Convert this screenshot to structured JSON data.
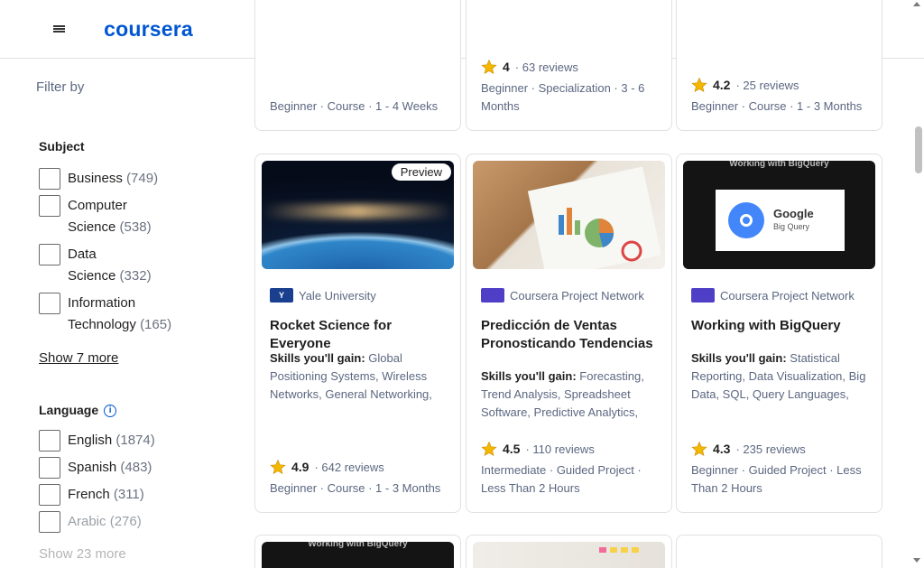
{
  "header": {
    "logo_text": "coursera",
    "brand_color": "#0056d2"
  },
  "sidebar": {
    "filter_by": "Filter by",
    "subject_title": "Subject",
    "subjects": [
      {
        "label": "Business",
        "count": "(749)"
      },
      {
        "label": "Computer",
        "label2": "Science",
        "count": "(538)"
      },
      {
        "label": "Data",
        "label2": "Science",
        "count": "(332)"
      },
      {
        "label": "Information",
        "label2": "Technology",
        "count": "(165)"
      }
    ],
    "subject_show_more": "Show 7 more",
    "language_title": "Language",
    "info_glyph": "i",
    "languages": [
      {
        "label": "English",
        "count": "(1874)"
      },
      {
        "label": "Spanish",
        "count": "(483)"
      },
      {
        "label": "French",
        "count": "(311)"
      },
      {
        "label": "Arabic",
        "count": "(276)"
      }
    ],
    "language_show_more": "Show 23 more"
  },
  "top_cards": [
    {
      "meta": "Beginner · Course · 1 - 4 Weeks"
    },
    {
      "rating": "4",
      "reviews": "63 reviews",
      "meta": "Beginner · Specialization · 3 - 6 Months"
    },
    {
      "rating": "4.2",
      "reviews": "25 reviews",
      "meta": "Beginner · Course · 1 - 3 Months"
    }
  ],
  "cards": [
    {
      "badge": "Preview",
      "partner": "Yale University",
      "partner_logo": "Y",
      "title": "Rocket Science for Everyone",
      "skills_label": "Skills you'll gain:",
      "skills": "Global Positioning Systems, Wireless Networks, General Networking, Satellite Communications",
      "rating": "4.9",
      "reviews": "642 reviews",
      "meta": "Beginner · Course · 1 - 3 Months"
    },
    {
      "partner": "Coursera Project Network",
      "partner_logo": "",
      "title": "Predicción de Ventas Pronosticando Tendencias",
      "skills_label": "Skills you'll gain:",
      "skills": "Forecasting, Trend Analysis, Spreadsheet Software, Predictive Analytics, Microsoft Excel",
      "rating": "4.5",
      "reviews": "110 reviews",
      "meta": "Intermediate · Guided Project · Less Than 2 Hours"
    },
    {
      "partner": "Coursera Project Network",
      "partner_logo": "",
      "title": "Working with BigQuery",
      "skills_label": "Skills you'll gain:",
      "skills": "Statistical Reporting, Data Visualization, Big Data, SQL, Query Languages, Data Analysis",
      "rating": "4.3",
      "reviews": "235 reviews",
      "meta": "Beginner · Guided Project · Less Than 2 Hours",
      "thumb_caption": "Working with BigQuery",
      "thumb_brand": "Google",
      "thumb_product": "Big Query"
    }
  ],
  "bottom_cards": [
    {
      "thumb_caption": "Working with BigQuery"
    }
  ],
  "colors": {
    "star": "#f5b800",
    "muted": "#5b6780"
  }
}
